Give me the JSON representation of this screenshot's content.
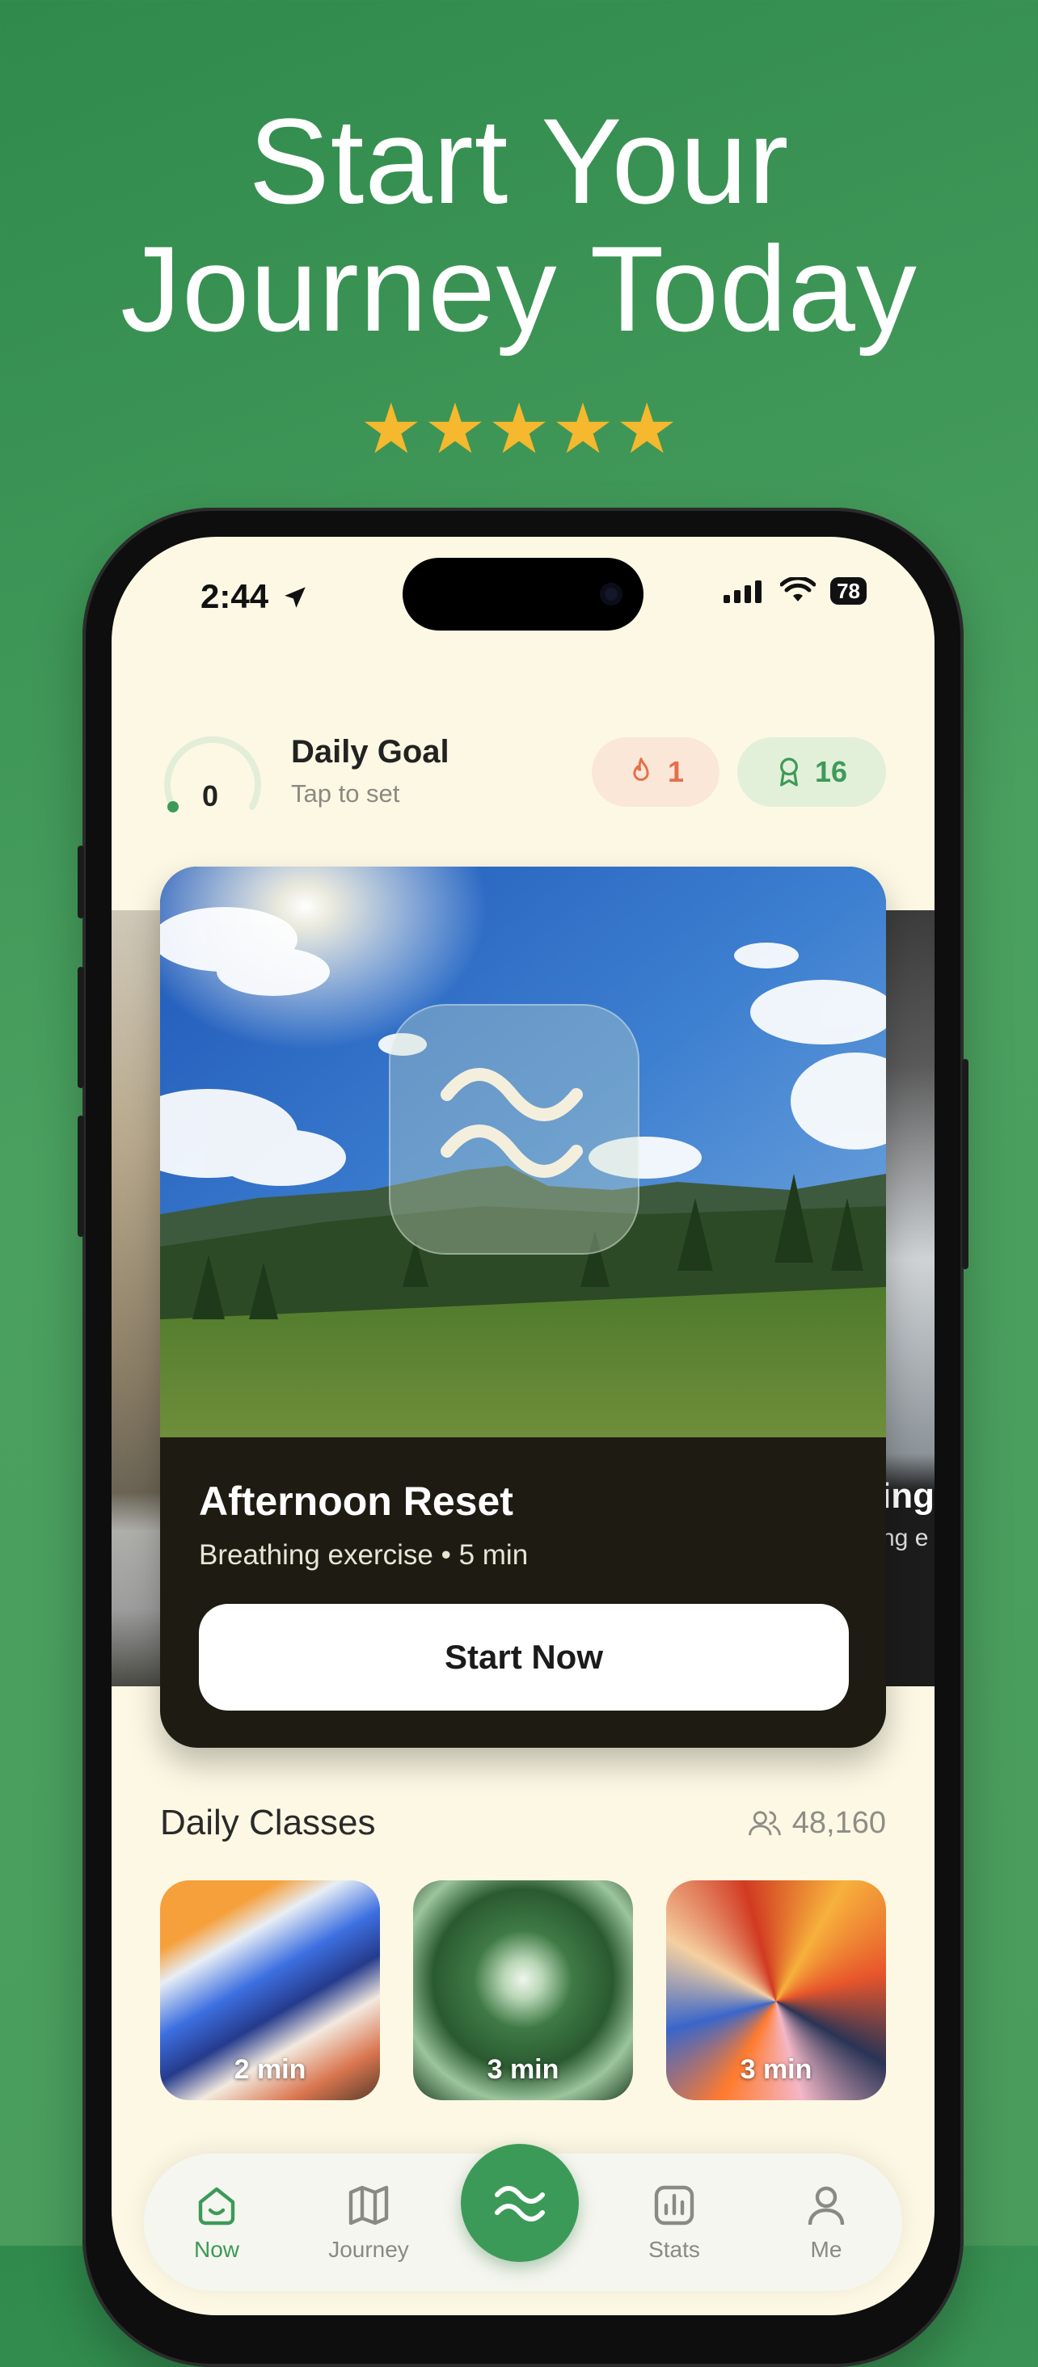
{
  "headline": {
    "line1": "Start Your",
    "line2": "Journey Today"
  },
  "rating": {
    "stars": 5,
    "glyph": "★"
  },
  "status_bar": {
    "time": "2:44",
    "battery": "78"
  },
  "daily_goal": {
    "value": "0",
    "title": "Daily Goal",
    "subtitle": "Tap to set"
  },
  "badges": {
    "streak": "1",
    "awards": "16"
  },
  "hero": {
    "title": "Afternoon Reset",
    "subtitle": "Breathing exercise • 5 min",
    "button": "Start Now",
    "peek_right_title": "ing",
    "peek_right_sub": "ng e"
  },
  "classes": {
    "title": "Daily Classes",
    "count": "48,160",
    "items": [
      {
        "duration": "2 min"
      },
      {
        "duration": "3 min"
      },
      {
        "duration": "3 min"
      }
    ]
  },
  "tabs": [
    {
      "label": "Now",
      "icon": "home-smile-icon",
      "active": true
    },
    {
      "label": "Journey",
      "icon": "map-icon",
      "active": false
    },
    {
      "label": "",
      "icon": "breath-waves-icon",
      "active": false
    },
    {
      "label": "Stats",
      "icon": "bar-chart-icon",
      "active": false
    },
    {
      "label": "Me",
      "icon": "person-icon",
      "active": false
    }
  ],
  "colors": {
    "brand_green": "#3c9a58",
    "background": "#4aa05f",
    "cream": "#fdf8e4",
    "star": "#f5b82e",
    "streak": "#e56f4b"
  }
}
